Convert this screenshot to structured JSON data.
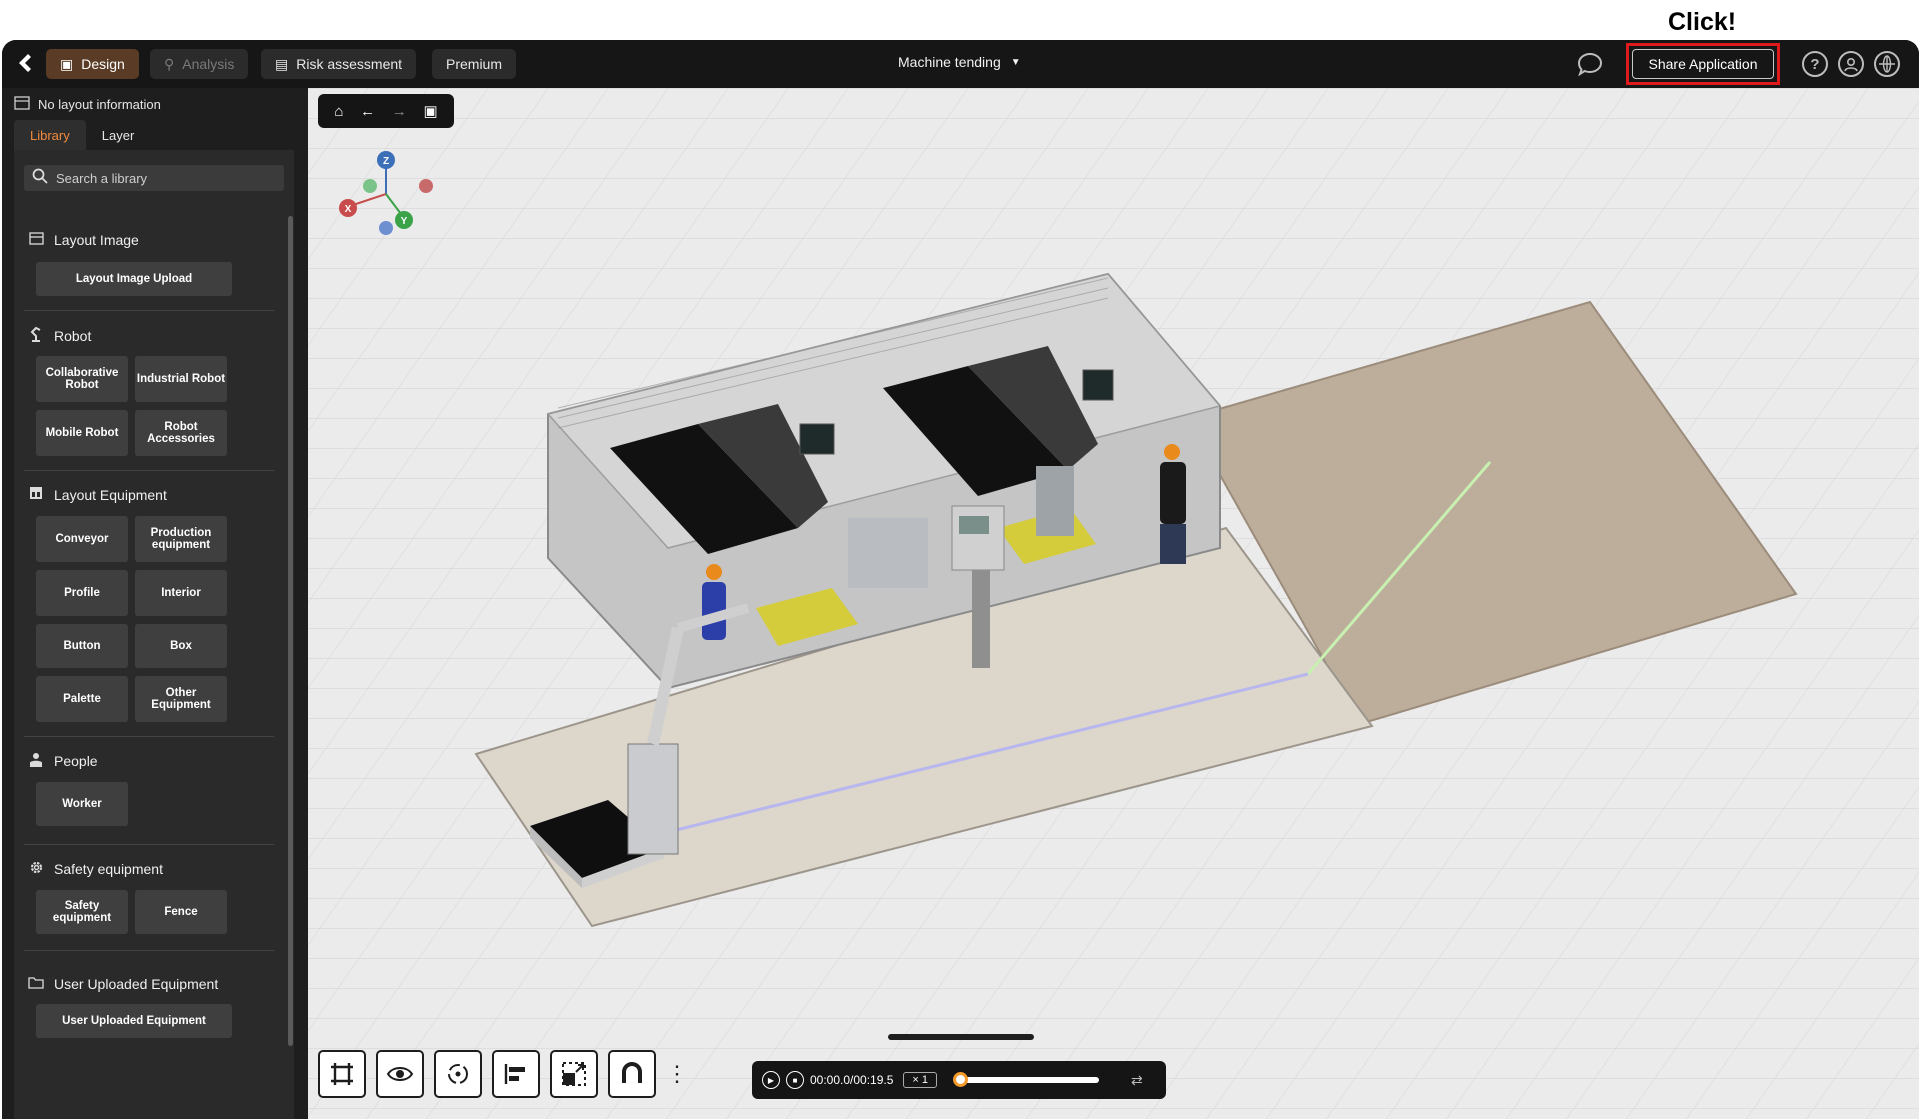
{
  "annotation": {
    "text": "Click!"
  },
  "header": {
    "tabs": [
      {
        "label": "Design",
        "icon": "design-icon",
        "state": "active"
      },
      {
        "label": "Analysis",
        "icon": "analysis-icon",
        "state": "disabled"
      },
      {
        "label": "Risk assessment",
        "icon": "document-icon",
        "state": "normal"
      },
      {
        "label": "Premium",
        "state": "normal"
      }
    ],
    "project_name": "Machine tending",
    "share_label": "Share Application",
    "icons": [
      "chat-icon",
      "help-icon",
      "account-icon",
      "language-icon"
    ]
  },
  "sidebar": {
    "layout_info": "No layout information",
    "tabs": [
      {
        "label": "Library",
        "state": "active"
      },
      {
        "label": "Layer"
      }
    ],
    "search_placeholder": "Search a library",
    "sections": [
      {
        "title": "Layout Image",
        "icon": "image-icon",
        "buttons": [
          "Layout Image Upload"
        ]
      },
      {
        "title": "Robot",
        "icon": "robot-arm-icon",
        "buttons": [
          "Collaborative Robot",
          "Industrial Robot",
          "Mobile Robot",
          "Robot Accessories"
        ]
      },
      {
        "title": "Layout Equipment",
        "icon": "layout-icon",
        "buttons": [
          "Conveyor",
          "Production equipment",
          "Profile",
          "Interior",
          "Button",
          "Box",
          "Palette",
          "Other Equipment"
        ]
      },
      {
        "title": "People",
        "icon": "person-icon",
        "buttons": [
          "Worker"
        ]
      },
      {
        "title": "Safety equipment",
        "icon": "gear-icon",
        "buttons": [
          "Safety equipment",
          "Fence"
        ]
      },
      {
        "title": "User Uploaded Equipment",
        "icon": "folder-icon",
        "buttons": [
          "User Uploaded Equipment"
        ]
      }
    ]
  },
  "player": {
    "time": "00:00.0/00:19.5",
    "speed": "× 1",
    "progress": 0
  },
  "axes": {
    "x": "X",
    "y": "Y",
    "z": "Z"
  },
  "colors": {
    "accent": "#f08a3c",
    "share_highlight": "#e0191b",
    "active_tab": "#5a3c26"
  }
}
